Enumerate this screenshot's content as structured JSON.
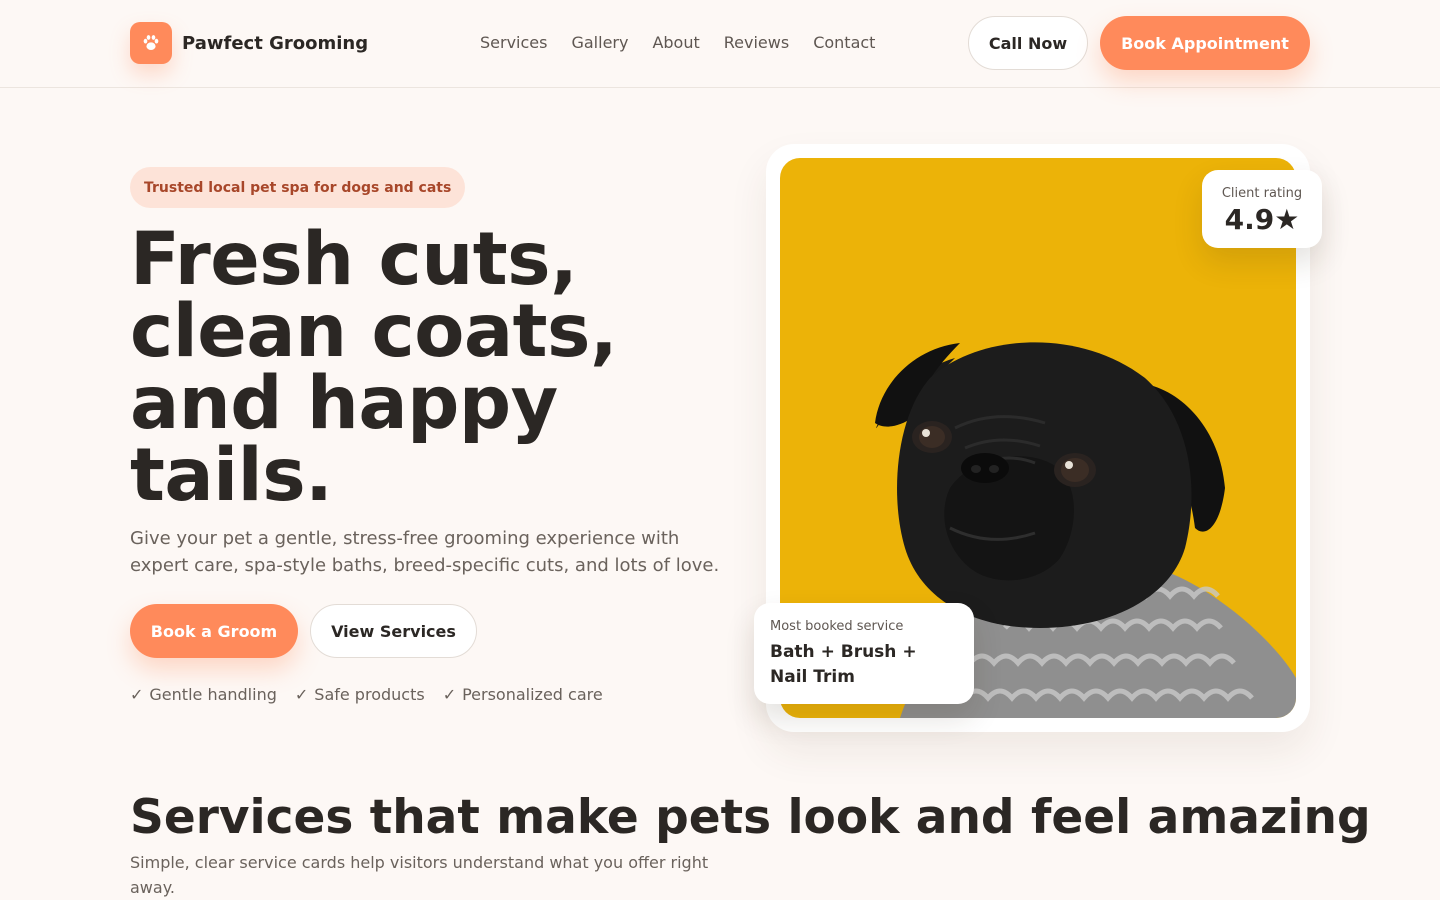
{
  "brand": {
    "name": "Pawfect Grooming",
    "logo_icon": "paw-icon"
  },
  "nav": {
    "items": [
      "Services",
      "Gallery",
      "About",
      "Reviews",
      "Contact"
    ]
  },
  "header_actions": {
    "call_label": "Call Now",
    "book_label": "Book Appointment"
  },
  "hero": {
    "badge": "Trusted local pet spa for dogs and cats",
    "title_lines": [
      "Fresh cuts,",
      "clean coats,",
      "and happy",
      "tails."
    ],
    "description": "Give your pet a gentle, stress-free grooming experience with expert care, spa-style baths, breed-specific cuts, and lots of love.",
    "primary_cta": "Book a Groom",
    "secondary_cta": "View Services",
    "features": [
      "Gentle handling",
      "Safe products",
      "Personalized care"
    ],
    "feature_icon": "check-icon"
  },
  "photo": {
    "subject": "pug-photo",
    "background_color": "#ECB308"
  },
  "rating_card": {
    "label": "Client rating",
    "value": "4.9★"
  },
  "service_card": {
    "label": "Most booked service",
    "value": "Bath + Brush + Nail Trim"
  },
  "services_section": {
    "title": "Services that make pets look and feel amazing",
    "description": "Simple, clear service cards help visitors understand what you offer right away."
  },
  "colors": {
    "accent": "#FF8A5B",
    "badge_bg": "#FDE3D8",
    "badge_text": "#A8472A",
    "page_bg": "#FDF8F5",
    "text": "#2B2724"
  }
}
